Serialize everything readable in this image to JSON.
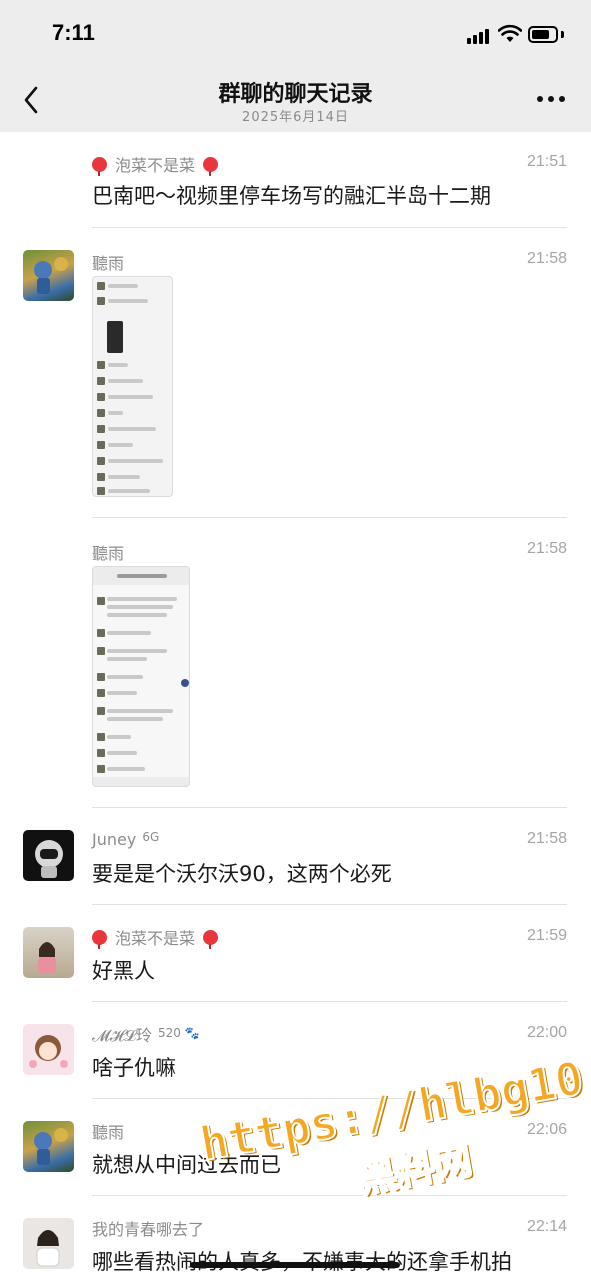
{
  "status_bar": {
    "time": "7:11",
    "battery_level": 0.75
  },
  "header": {
    "title": "群聊的聊天记录",
    "subtitle": "2025年6月14日"
  },
  "messages": [
    {
      "sender": "泡菜不是菜",
      "time": "21:51",
      "text": "巴南吧～视频里停车场写的融汇半岛十二期"
    },
    {
      "sender": "聽雨",
      "time": "21:58",
      "kind": "image"
    },
    {
      "sender": "聽雨",
      "time": "21:58",
      "kind": "image"
    },
    {
      "sender": "Juney",
      "sender_suffix": "6G",
      "time": "21:58",
      "text": "要是是个沃尔沃90，这两个必死"
    },
    {
      "sender": "泡菜不是菜",
      "time": "21:59",
      "text": "好黑人"
    },
    {
      "sender": "𝓜𝓗𝓛玲",
      "sender_suffix": "520 🐾",
      "time": "22:00",
      "text": "啥子仇嘛"
    },
    {
      "sender": "聽雨",
      "time": "22:06",
      "text": "就想从中间过去而已"
    },
    {
      "sender": "我的青春哪去了",
      "time": "22:14",
      "text": "哪些看热闹的人真多，不嫌事大的还拿手机拍"
    }
  ],
  "watermark": {
    "url": "https://hlbg10.com",
    "name": "黑料网"
  },
  "colors": {
    "header_bg": "#ededed",
    "watermark": "#f5a623",
    "balloon": "#e8363c"
  },
  "icons": [
    "back-arrow-icon",
    "more-options-icon",
    "signal-icon",
    "wifi-icon",
    "battery-icon",
    "balloon-icon"
  ]
}
